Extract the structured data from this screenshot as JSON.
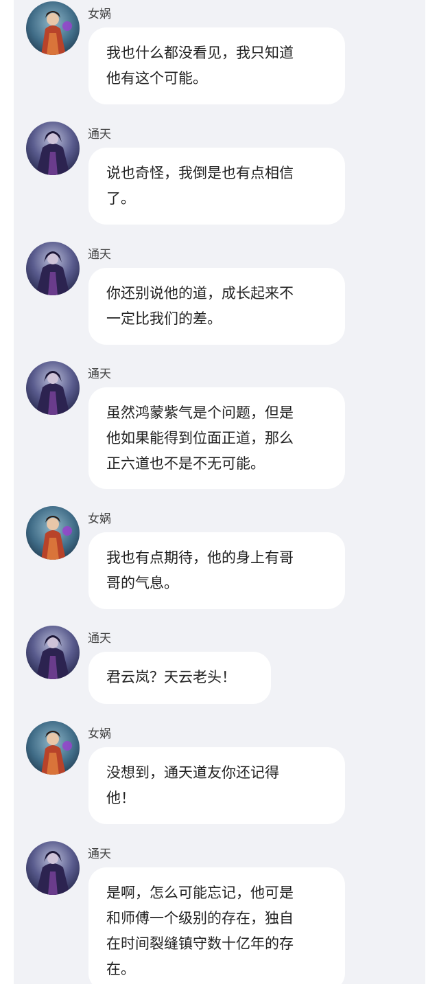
{
  "messages": [
    {
      "sender": "女娲",
      "avatar": "nuwa-avatar",
      "text": "我也什么都没看见，我只知道\n他有这个可能。"
    },
    {
      "sender": "通天",
      "avatar": "tongtian-avatar",
      "text": "说也奇怪，我倒是也有点相信\n了。"
    },
    {
      "sender": "通天",
      "avatar": "tongtian-avatar",
      "text": "你还别说他的道，成长起来不\n一定比我们的差。"
    },
    {
      "sender": "通天",
      "avatar": "tongtian-avatar",
      "text": "虽然鸿蒙紫气是个问题，但是\n他如果能得到位面正道，那么\n正六道也不是不无可能。"
    },
    {
      "sender": "女娲",
      "avatar": "nuwa-avatar",
      "text": "我也有点期待，他的身上有哥\n哥的气息。"
    },
    {
      "sender": "通天",
      "avatar": "tongtian-avatar",
      "text": "君云岚？天云老头！"
    },
    {
      "sender": "女娲",
      "avatar": "nuwa-avatar",
      "text": "没想到，通天道友你还记得\n他！"
    },
    {
      "sender": "通天",
      "avatar": "tongtian-avatar",
      "text": "是啊，怎么可能忘记，他可是\n和师傅一个级别的存在，独自\n在时间裂缝镇守数十亿年的存\n在。"
    }
  ]
}
